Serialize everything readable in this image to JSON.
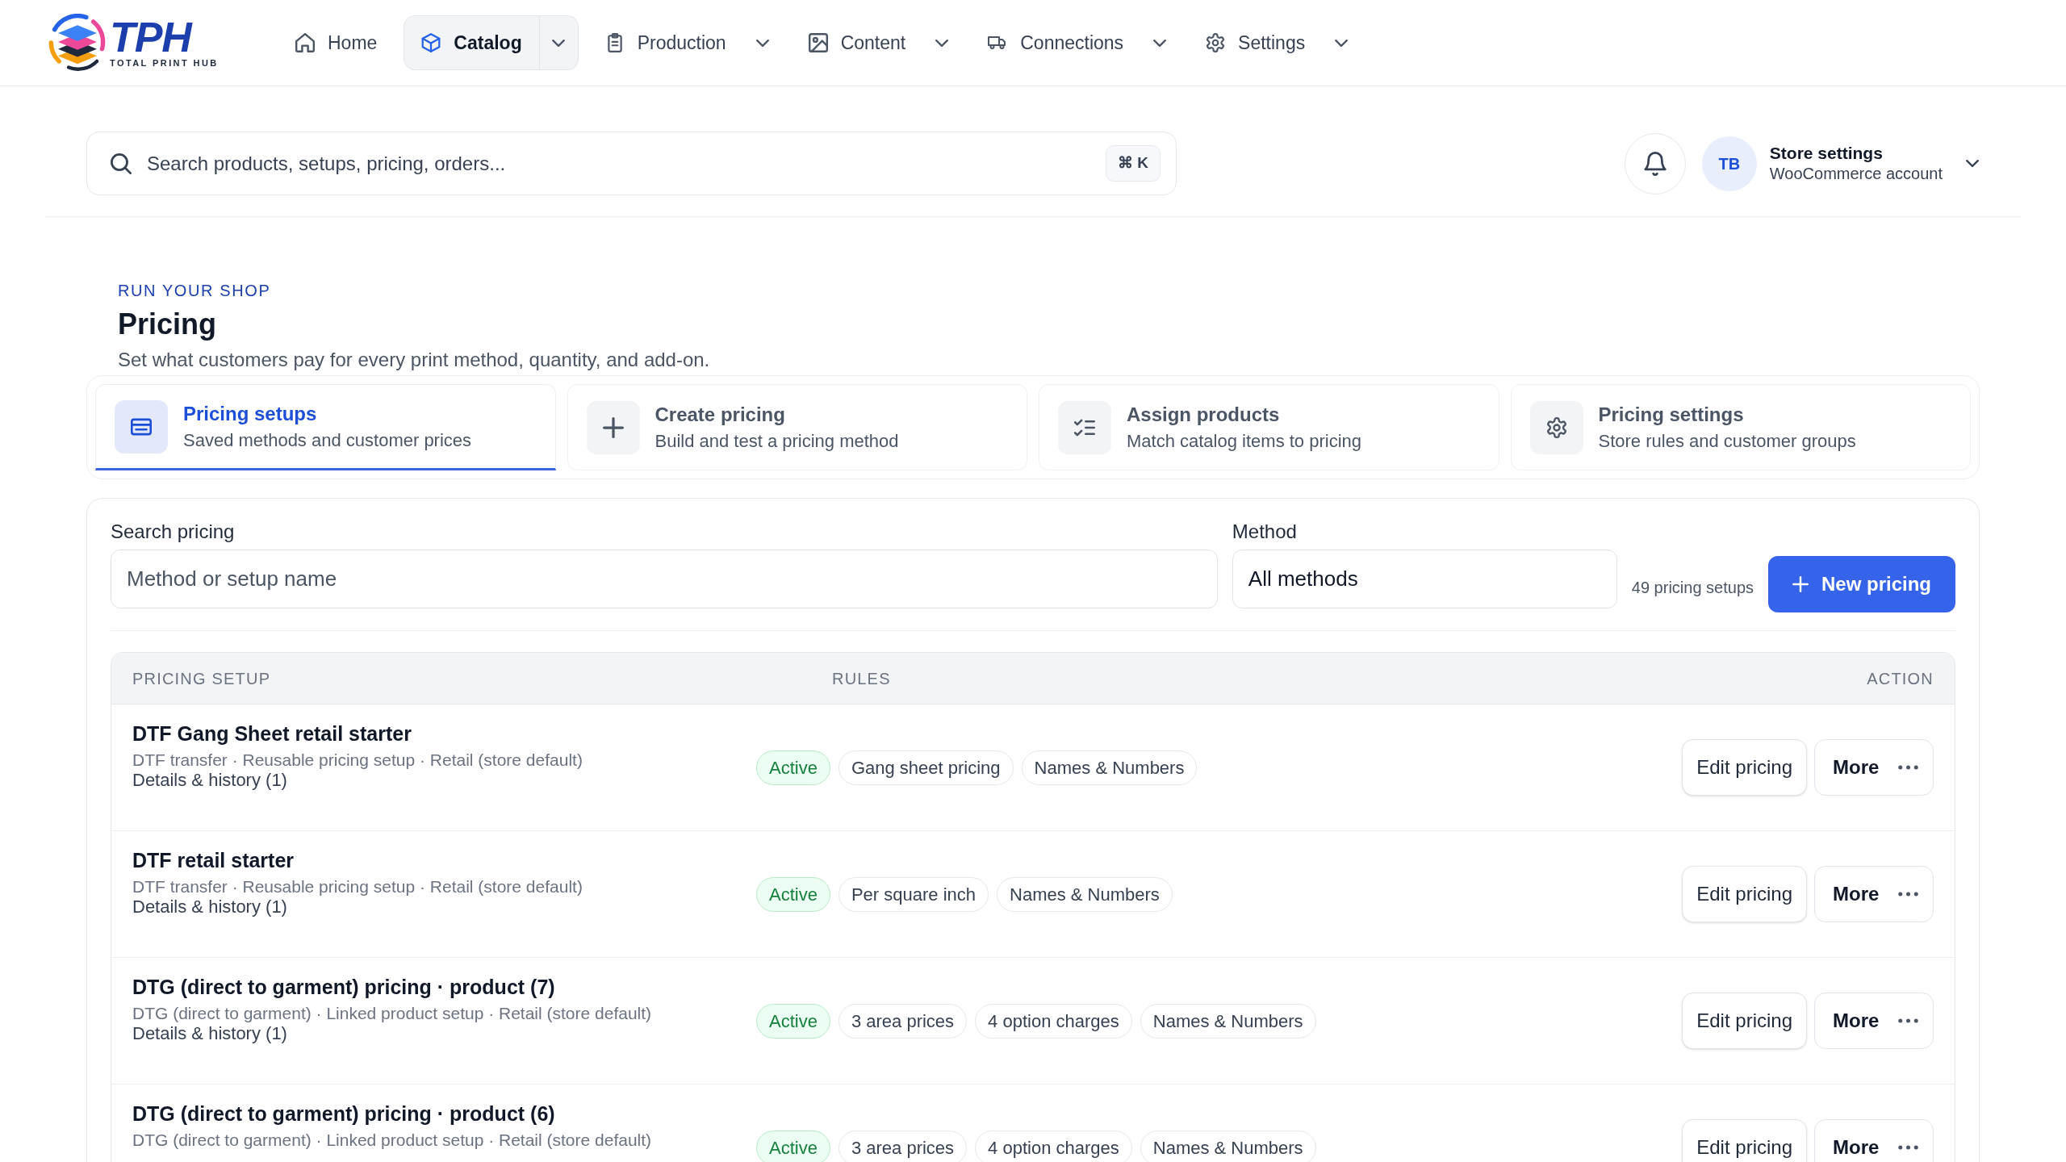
{
  "logo": {
    "wordmark": "TPH",
    "tagline": "TOTAL PRINT HUB"
  },
  "nav": [
    {
      "label": "Home",
      "selected": false,
      "menu": false
    },
    {
      "label": "Catalog",
      "selected": true,
      "menu": true
    },
    {
      "label": "Production",
      "selected": false,
      "menu": true
    },
    {
      "label": "Content",
      "selected": false,
      "menu": true
    },
    {
      "label": "Connections",
      "selected": false,
      "menu": true
    },
    {
      "label": "Settings",
      "selected": false,
      "menu": true
    }
  ],
  "search": {
    "placeholder": "Search products, setups, pricing, orders...",
    "shortcut": "⌘ K"
  },
  "account": {
    "initials": "TB",
    "title": "Store settings",
    "subtitle": "WooCommerce account"
  },
  "page": {
    "eyebrow": "RUN YOUR SHOP",
    "title": "Pricing",
    "description": "Set what customers pay for every print method, quantity, and add-on."
  },
  "tabs": [
    {
      "title": "Pricing setups",
      "subtitle": "Saved methods and customer prices",
      "selected": true
    },
    {
      "title": "Create pricing",
      "subtitle": "Build and test a pricing method",
      "selected": false
    },
    {
      "title": "Assign products",
      "subtitle": "Match catalog items to pricing",
      "selected": false
    },
    {
      "title": "Pricing settings",
      "subtitle": "Store rules and customer groups",
      "selected": false
    }
  ],
  "filters": {
    "search": {
      "label": "Search pricing",
      "placeholder": "Method or setup name"
    },
    "method": {
      "label": "Method",
      "value": "All methods"
    },
    "count": "49 pricing setups",
    "new_button": "New pricing"
  },
  "table": {
    "columns": [
      "PRICING SETUP",
      "RULES",
      "ACTION"
    ],
    "rows": [
      {
        "title": "DTF Gang Sheet retail starter",
        "meta": "DTF transfer · Reusable pricing setup · Retail (store default)",
        "details": "Details & history (1)",
        "tags": [
          {
            "label": "Active",
            "kind": "status"
          },
          {
            "label": "Gang sheet pricing",
            "kind": "rule"
          },
          {
            "label": "Names & Numbers",
            "kind": "rule"
          }
        ],
        "edit": "Edit pricing",
        "more": "More"
      },
      {
        "title": "DTF retail starter",
        "meta": "DTF transfer · Reusable pricing setup · Retail (store default)",
        "details": "Details & history (1)",
        "tags": [
          {
            "label": "Active",
            "kind": "status"
          },
          {
            "label": "Per square inch",
            "kind": "rule"
          },
          {
            "label": "Names & Numbers",
            "kind": "rule"
          }
        ],
        "edit": "Edit pricing",
        "more": "More"
      },
      {
        "title": "DTG (direct to garment) pricing · product (7)",
        "meta": "DTG (direct to garment) · Linked product setup · Retail (store default)",
        "details": "Details & history (1)",
        "tags": [
          {
            "label": "Active",
            "kind": "status"
          },
          {
            "label": "3 area prices",
            "kind": "rule"
          },
          {
            "label": "4 option charges",
            "kind": "rule"
          },
          {
            "label": "Names & Numbers",
            "kind": "rule"
          }
        ],
        "edit": "Edit pricing",
        "more": "More"
      },
      {
        "title": "DTG (direct to garment) pricing · product (6)",
        "meta": "DTG (direct to garment) · Linked product setup · Retail (store default)",
        "tags": [
          {
            "label": "Active",
            "kind": "status"
          },
          {
            "label": "3 area prices",
            "kind": "rule"
          },
          {
            "label": "4 option charges",
            "kind": "rule"
          },
          {
            "label": "Names & Numbers",
            "kind": "rule"
          }
        ],
        "edit": "Edit pricing",
        "more": "More"
      }
    ]
  }
}
